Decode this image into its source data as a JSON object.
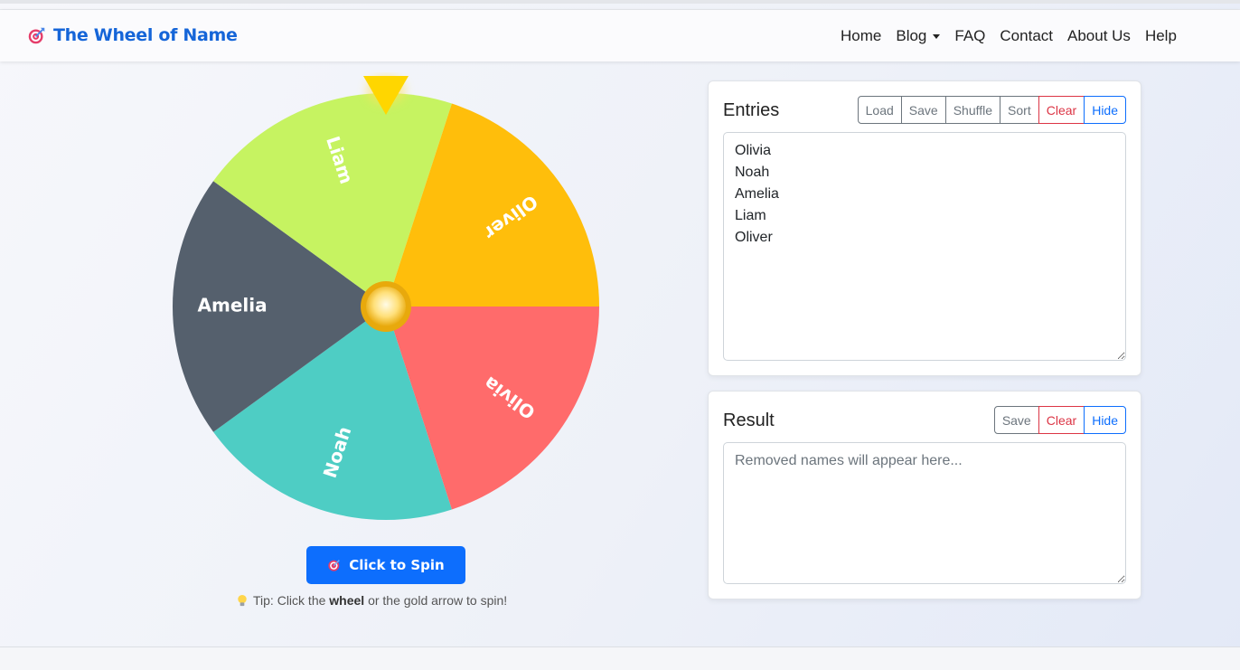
{
  "app": {
    "brand": "The Wheel of Name",
    "brand_icon": "target-icon",
    "accent": "#1565d8"
  },
  "nav": {
    "items": [
      {
        "label": "Home"
      },
      {
        "label": "Blog",
        "dropdown": true
      },
      {
        "label": "FAQ"
      },
      {
        "label": "Contact"
      },
      {
        "label": "About Us"
      },
      {
        "label": "Help"
      }
    ]
  },
  "wheel": {
    "segments": [
      {
        "name": "Olivia",
        "color": "#ff6b6b"
      },
      {
        "name": "Noah",
        "color": "#4ecdc4"
      },
      {
        "name": "Amelia",
        "color": "#55606d"
      },
      {
        "name": "Liam",
        "color": "#c6f361"
      },
      {
        "name": "Oliver",
        "color": "#ffbe0b"
      }
    ],
    "pointer_color": "#ffd600",
    "hub_color": "#f5c542"
  },
  "spin": {
    "button_label": "Click to Spin",
    "tip_prefix": "Tip: Click the",
    "tip_bold": "wheel",
    "tip_suffix": "or the gold arrow to spin!"
  },
  "entries": {
    "title": "Entries",
    "buttons": [
      "Load",
      "Save",
      "Shuffle",
      "Sort",
      "Clear",
      "Hide"
    ],
    "value": "Olivia\nNoah\nAmelia\nLiam\nOliver"
  },
  "result": {
    "title": "Result",
    "buttons": [
      "Save",
      "Clear",
      "Hide"
    ],
    "placeholder": "Removed names will appear here..."
  }
}
